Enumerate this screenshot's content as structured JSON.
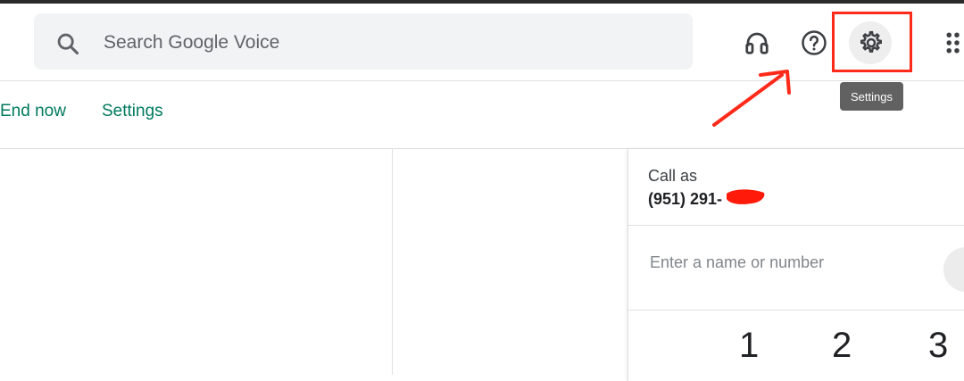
{
  "header": {
    "search": {
      "placeholder": "Search Google Voice",
      "value": ""
    },
    "icons": [
      "headset-icon",
      "help-icon",
      "settings-icon",
      "apps-icon"
    ],
    "tooltip": "Settings"
  },
  "subbar": {
    "end_now_label": "End now",
    "settings_label": "Settings"
  },
  "dialer": {
    "call_as_label": "Call as",
    "call_as_number": "(951) 291-",
    "input": {
      "placeholder": "Enter a name or number",
      "value": ""
    },
    "keys": [
      "1",
      "2",
      "3"
    ]
  },
  "colors": {
    "accent_green": "#007a5e",
    "annotation_red": "#ff2a1a",
    "search_bg": "#f1f3f4",
    "tooltip_bg": "#616161"
  }
}
